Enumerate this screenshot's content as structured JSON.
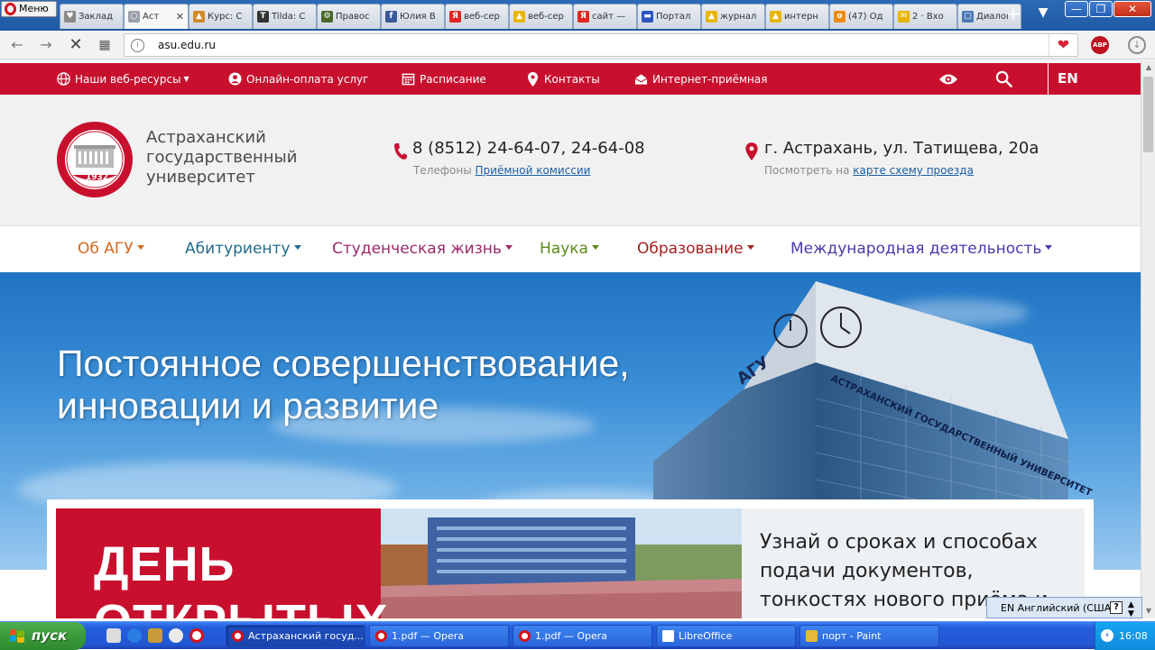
{
  "browser": {
    "menu_label": "Меню",
    "tabs": [
      {
        "label": "Заклад",
        "icon": "heart-icon",
        "color": "#8a8a8a"
      },
      {
        "label": "Аст",
        "icon": "loading-icon",
        "color": "#9aa0a8",
        "active": true
      },
      {
        "label": "Курс: С",
        "icon": "course-icon",
        "color": "#d28a2a"
      },
      {
        "label": "Tilda: С",
        "icon": "tilda-icon",
        "color": "#333333"
      },
      {
        "label": "Правос",
        "icon": "gear-icon",
        "color": "#4a6a2a"
      },
      {
        "label": "Юлия В",
        "icon": "facebook-icon",
        "color": "#3b5998"
      },
      {
        "label": "веб-сер",
        "icon": "yandex-icon",
        "color": "#e52620"
      },
      {
        "label": "веб-сер",
        "icon": "tent-icon",
        "color": "#e8b400"
      },
      {
        "label": "сайт —",
        "icon": "yandex-icon",
        "color": "#e52620"
      },
      {
        "label": "Портал",
        "icon": "flag-icon",
        "color": "#2b55c4"
      },
      {
        "label": "журнал",
        "icon": "tent-icon",
        "color": "#e8b400"
      },
      {
        "label": "интерн",
        "icon": "tent-icon",
        "color": "#e8b400"
      },
      {
        "label": "(47) Од",
        "icon": "ok-icon",
        "color": "#f08a10"
      },
      {
        "label": "2 · Вхо",
        "icon": "mail-icon",
        "color": "#e8b400"
      },
      {
        "label": "Диалог",
        "icon": "chat-icon",
        "color": "#4b79b8"
      }
    ],
    "url": "asu.edu.ru",
    "abp_label": "ABP"
  },
  "topbar": {
    "items": [
      {
        "label": "Наши веб-ресурсы",
        "icon": "globe-icon"
      },
      {
        "label": "Онлайн-оплата услуг",
        "icon": "user-icon"
      },
      {
        "label": "Расписание",
        "icon": "calendar-icon"
      },
      {
        "label": "Контакты",
        "icon": "pin-icon"
      },
      {
        "label": "Интернет-приёмная",
        "icon": "envelope-icon"
      }
    ],
    "lang": "EN"
  },
  "header": {
    "logo_year": "1932",
    "name_line1": "Астраханский",
    "name_line2": "государственный",
    "name_line3": "университет",
    "phone": "8 (8512) 24-64-07, 24-64-08",
    "phone_sub_prefix": "Телефоны ",
    "phone_sub_link": "Приёмной комиссии",
    "address": "г. Астрахань, ул. Татищева, 20а",
    "address_sub_prefix": "Посмотреть на ",
    "address_sub_link": "карте схему проезда"
  },
  "mainnav": [
    {
      "label": "Об АГУ",
      "color": "#d2691e"
    },
    {
      "label": "Абитуриенту",
      "color": "#1f6b8a"
    },
    {
      "label": "Студенческая жизнь",
      "color": "#9b2a6a"
    },
    {
      "label": "Наука",
      "color": "#5a8a1a"
    },
    {
      "label": "Образование",
      "color": "#a51f1f"
    },
    {
      "label": "Международная деятельность",
      "color": "#4a3aa8"
    }
  ],
  "hero": {
    "title_line1": "Постоянное совершенствование,",
    "title_line2": "инновации и развитие",
    "building_sign": "АСТРАХАНСКИЙ ГОСУДАРСТВЕННЫЙ УНИВЕРСИТЕТ",
    "building_logo": "АГУ"
  },
  "banner": {
    "big_line1": "ДЕНЬ",
    "big_line2": "ОТКРЫТЫХ",
    "text": "Узнай о сроках и способах подачи документов, тонкостях нового приёма и выбери"
  },
  "langbar": {
    "label": "EN Английский (США)",
    "help": "?"
  },
  "taskbar": {
    "start_label": "пуск",
    "tasks": [
      {
        "label": "Астраханский госуд...",
        "icon": "opera-icon",
        "active": true
      },
      {
        "label": "1.pdf — Opera",
        "icon": "opera-icon"
      },
      {
        "label": "1.pdf — Opera",
        "icon": "opera-icon"
      },
      {
        "label": "LibreOffice",
        "icon": "document-icon"
      },
      {
        "label": "порт - Paint",
        "icon": "paint-icon"
      }
    ],
    "clock": "16:08"
  },
  "colors": {
    "brand_red": "#c8102e",
    "link": "#1a5ea8"
  }
}
